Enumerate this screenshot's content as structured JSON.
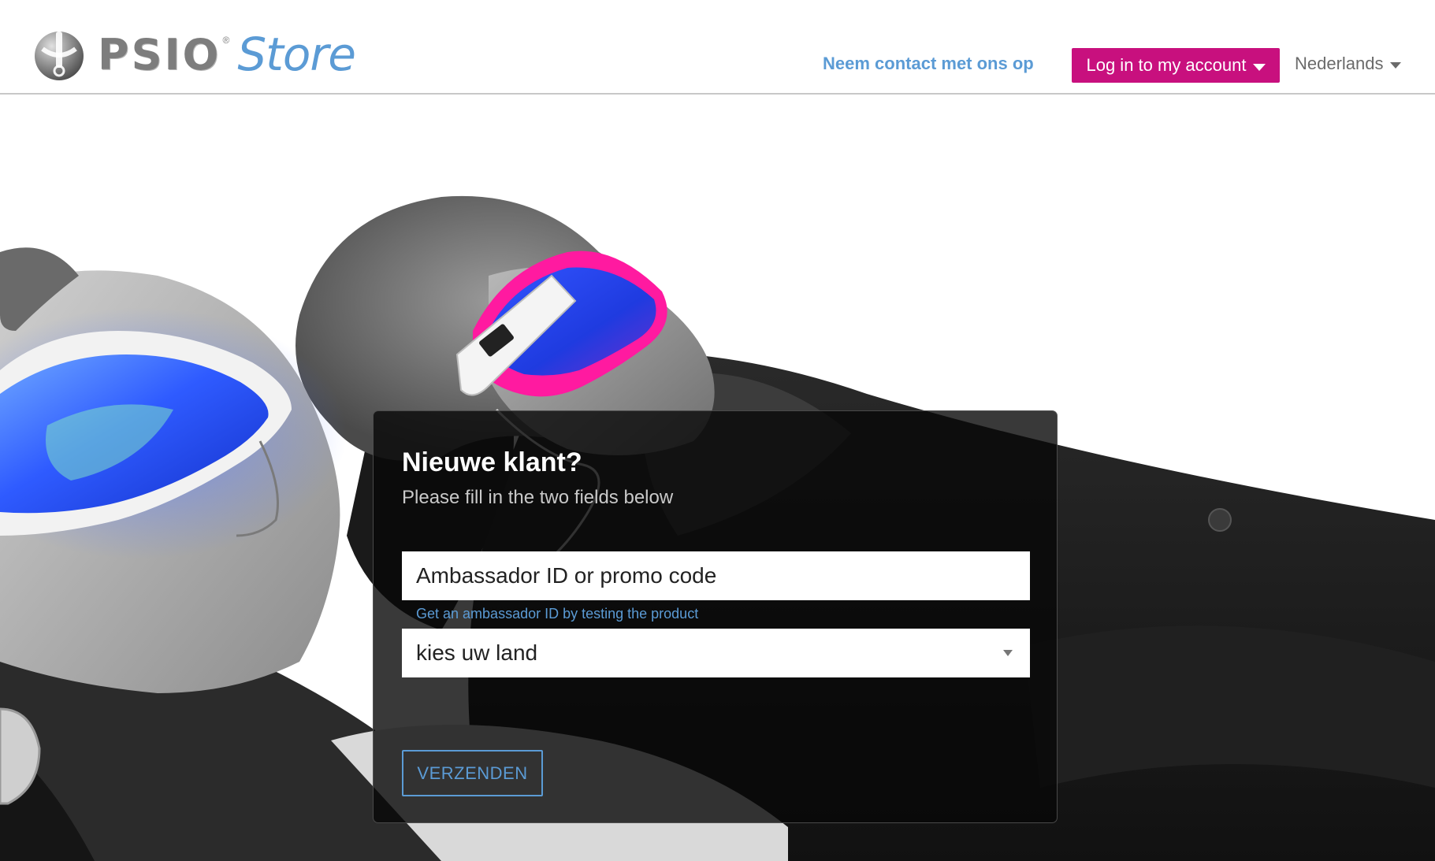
{
  "header": {
    "logo_text": "PSIO",
    "logo_reg": "®",
    "logo_store": "Store",
    "contact_link": "Neem contact met ons op",
    "login_button": "Log in to my account",
    "language": "Nederlands"
  },
  "form": {
    "title": "Nieuwe klant?",
    "subtitle": "Please fill in the two fields below",
    "promo_placeholder": "Ambassador ID or promo code",
    "help_link": "Get an ambassador ID by testing the product",
    "country_select": "kies uw land",
    "submit_button": "VERZENDEN"
  },
  "hero": {
    "image_description": "Black-and-white photo of two people reclining with colored light-therapy glasses (blue and magenta)"
  },
  "colors": {
    "accent_blue": "#5b9bd5",
    "login_magenta": "#c8107e",
    "panel_bg": "#0a0a0a",
    "glasses_blue": "#2f5bff",
    "glasses_magenta": "#ff1aa0"
  }
}
